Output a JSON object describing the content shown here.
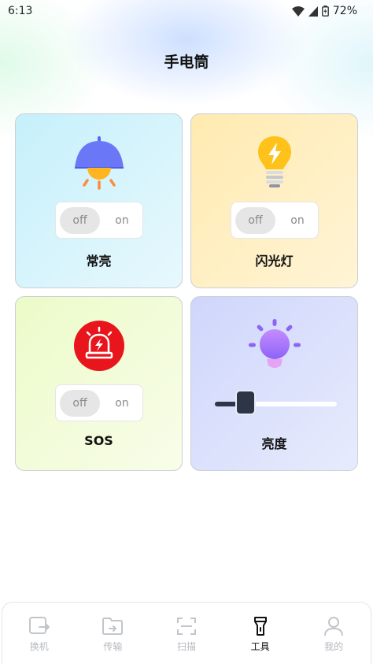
{
  "status_bar": {
    "time": "6:13",
    "battery": "72%"
  },
  "page": {
    "title": "手电筒"
  },
  "cards": {
    "steady": {
      "label": "常亮",
      "toggle_off": "off",
      "toggle_on": "on",
      "state": "off"
    },
    "flash": {
      "label": "闪光灯",
      "toggle_off": "off",
      "toggle_on": "on",
      "state": "off"
    },
    "sos": {
      "label": "SOS",
      "toggle_off": "off",
      "toggle_on": "on",
      "state": "off"
    },
    "brightness": {
      "label": "亮度",
      "level": 0.2
    }
  },
  "nav": {
    "items": [
      {
        "label": "换机",
        "icon": "phone-transfer-icon",
        "active": false
      },
      {
        "label": "传输",
        "icon": "folder-transfer-icon",
        "active": false
      },
      {
        "label": "扫描",
        "icon": "scan-icon",
        "active": false
      },
      {
        "label": "工具",
        "icon": "flashlight-icon",
        "active": true
      },
      {
        "label": "我的",
        "icon": "user-icon",
        "active": false
      }
    ]
  },
  "colors": {
    "card_steady_bg": "#d6f3fb",
    "card_flash_bg": "#fff1c9",
    "card_sos_bg": "#f1fbd8",
    "card_brightness_bg": "#dce3fb",
    "sos_red": "#e8151c",
    "active_nav": "#111111",
    "inactive_nav": "#b5b8bd"
  }
}
